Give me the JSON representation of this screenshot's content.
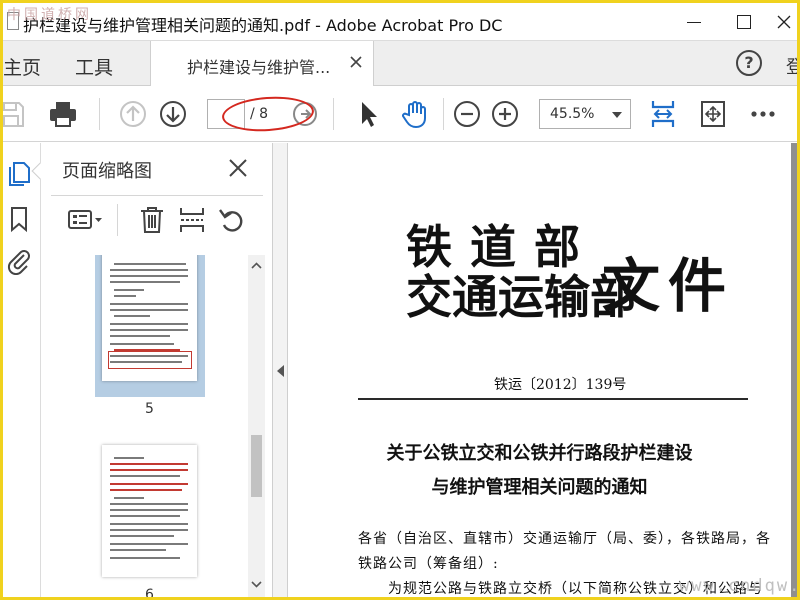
{
  "window": {
    "title": "护栏建设与维护管理相关问题的通知.pdf - Adobe Acrobat Pro DC"
  },
  "nav": {
    "home_label": "主页",
    "tools_label": "工具",
    "doc_tab_label": "护栏建设与维护管...",
    "help_label": "?",
    "sign_in_label": "登"
  },
  "toolbar": {
    "current_page": "",
    "page_total": "/ 8",
    "zoom_value": "45.5%"
  },
  "thumbnails": {
    "panel_title": "页面缩略图",
    "pages": [
      {
        "number": "5",
        "selected": true
      },
      {
        "number": "6",
        "selected": false
      }
    ]
  },
  "document": {
    "ministry_line1": "铁道部",
    "ministry_line2": "交通运输部",
    "doc_kind": "文件",
    "doc_number": "铁运〔2012〕139号",
    "headline_line1": "关于公铁立交和公铁并行路段护栏建设",
    "headline_line2": "与维护管理相关问题的通知",
    "body_line1": "各省（自治区、直辖市）交通运输厅（局、委），各铁路局，各",
    "body_line2": "铁路公司（筹备组）:",
    "body_line3": "为规范公路与铁路立交桥（以下简称公铁立交）和公路与"
  },
  "watermarks": {
    "top_left": "中国道桥网",
    "bottom_right": "www.cndqw.com"
  },
  "colors": {
    "frame_border": "#f0d21e",
    "accent_blue": "#1f6ec9",
    "annotation_red": "#d4281f"
  }
}
